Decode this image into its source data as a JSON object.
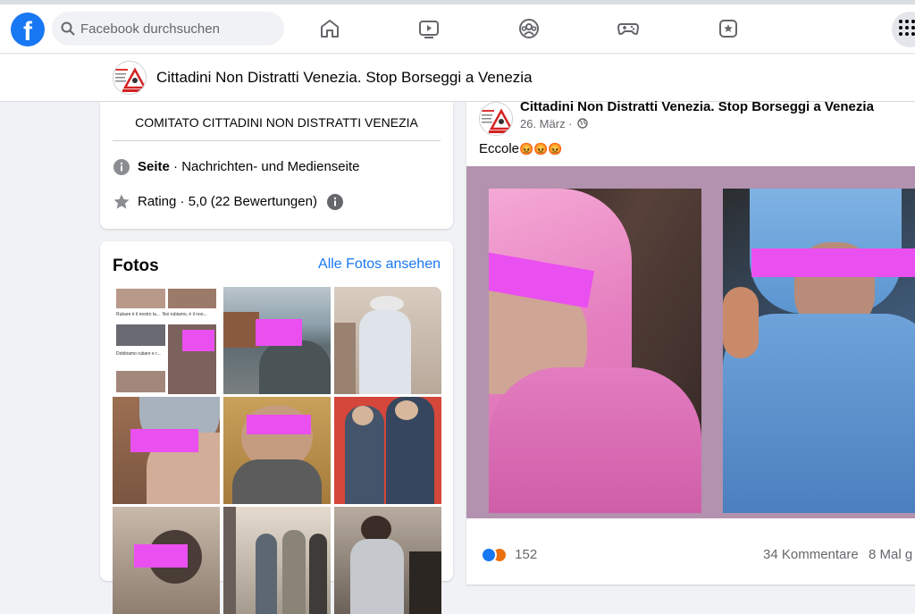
{
  "topbar": {
    "logo": "f",
    "search_placeholder": "Facebook durchsuchen",
    "nav_icons": [
      "home-icon",
      "watch-icon",
      "groups-icon",
      "gaming-icon",
      "bookmarks-icon"
    ],
    "menu_icon": "menu-grid-icon"
  },
  "page": {
    "name": "Cittadini Non Distratti Venezia. Stop Borseggi a Venezia"
  },
  "intro": {
    "committee": "COMITATO CITTADINI NON DISTRATTI VENEZIA",
    "type_bold": "Seite",
    "type_rest": " · Nachrichten- und Medienseite",
    "rating": "Rating · 5,0 (22 Bewertungen)"
  },
  "photos": {
    "title": "Fotos",
    "see_all": "Alle Fotos ansehen",
    "thumb_texts": [
      "Rubare è il nostro la...",
      "Noi rubiamo, è il noo...",
      "Dobbiamo rubare e r..."
    ]
  },
  "post": {
    "author": "Cittadini Non Distratti Venezia. Stop Borseggi a Venezia",
    "date": "26. März ·",
    "text": "Eccole",
    "emoji": "😡😡😡",
    "reaction_count": "152",
    "comments": "34 Kommentare",
    "shares": "8 Mal g"
  },
  "colors": {
    "brand": "#1877f2",
    "redaction": "#ea4ff0",
    "media_bg": "#b292ae"
  }
}
